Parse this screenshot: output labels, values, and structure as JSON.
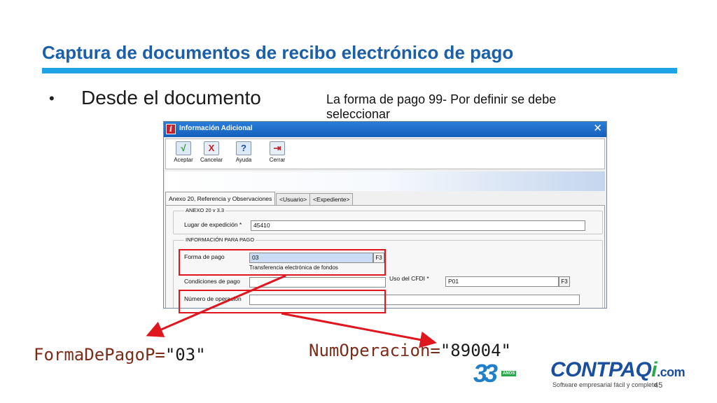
{
  "slide": {
    "title": "Captura de documentos de recibo electrónico de pago",
    "bullet_marker": "•",
    "bullet": "Desde el documento",
    "note": "La forma de pago 99- Por definir se debe seleccionar"
  },
  "dialog": {
    "title": "Información Adicional",
    "close": "✕",
    "toolbar": [
      {
        "label": "Aceptar",
        "icon": "check-icon",
        "glyph": "√"
      },
      {
        "label": "Cancelar",
        "icon": "cancel-icon",
        "glyph": "X"
      },
      {
        "label": "Ayuda",
        "icon": "help-icon",
        "glyph": "?"
      },
      {
        "label": "Cerrar",
        "icon": "exit-icon",
        "glyph": "⇥"
      }
    ],
    "tabs": [
      "Anexo 20, Referencia y Observaciones",
      "<Usuario>",
      "<Expediente>"
    ],
    "anexo_group": "ANEXO 20 v 3.3",
    "lugar_label": "Lugar de expedición *",
    "lugar_value": "45410",
    "pago_group": "INFORMACIÓN PARA PAGO",
    "forma_label": "Forma de pago",
    "forma_value": "03",
    "forma_desc": "Transferencia electrónica de fondos",
    "f3": "F3",
    "condiciones_label": "Condiciones de pago",
    "condiciones_value": "",
    "uso_label": "Uso del CFDI *",
    "uso_value": "P01",
    "numero_label": "Número de operación",
    "numero_value": ""
  },
  "annotations": {
    "forma_attr": "FormaDePagoP=",
    "forma_val": "\"03\"",
    "num_attr": "NumOperacion=",
    "num_val": "\"89004\""
  },
  "footer": {
    "anniversary": "33",
    "anniversary_tag": "AÑOS",
    "brand": "CONTPAQ",
    "brand_i": "i",
    "brand_suffix": ".com",
    "tagline": "Software empresarial fácil y completo",
    "page": "45"
  },
  "colors": {
    "title": "#1a5fa8",
    "rule": "#1ea3e6",
    "highlight": "#e0161f",
    "brand": "#1a4fa0"
  }
}
